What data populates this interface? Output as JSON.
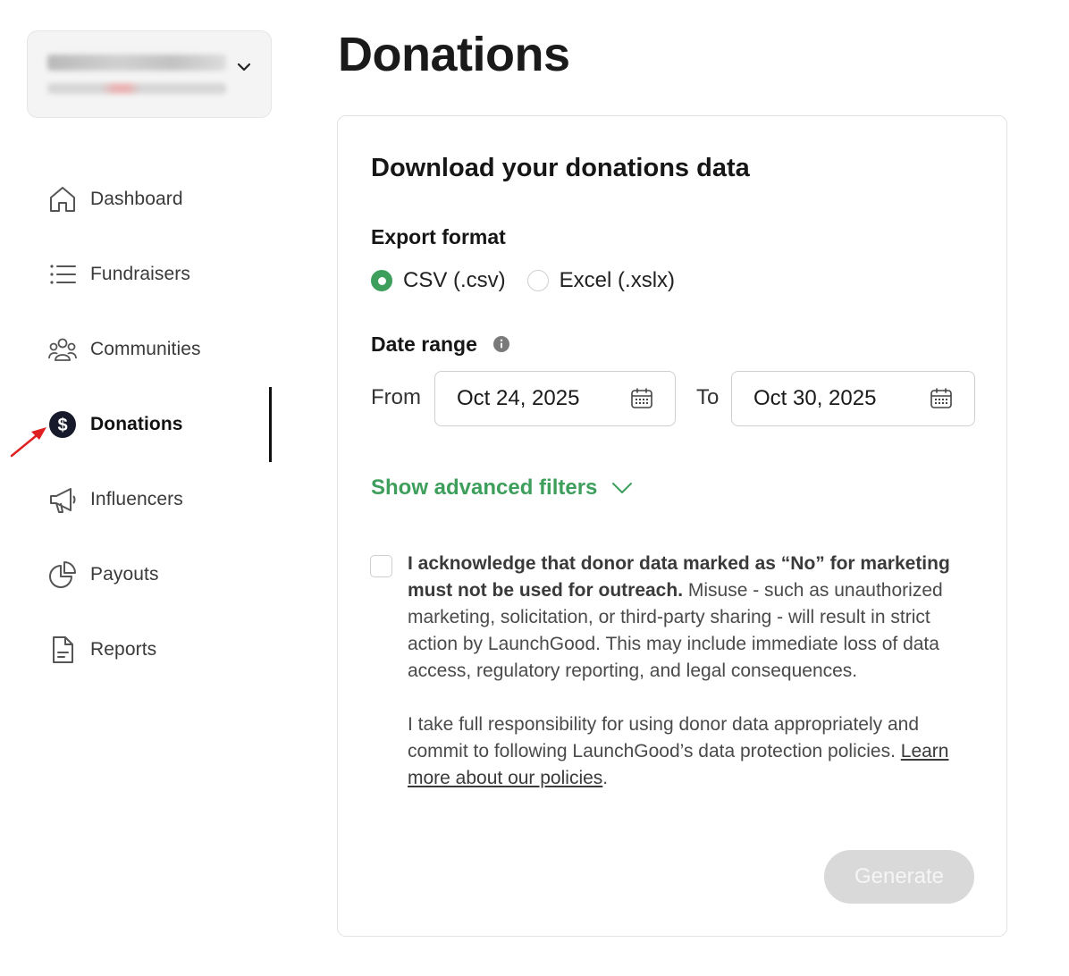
{
  "page": {
    "title": "Donations"
  },
  "sidebar": {
    "items": [
      {
        "label": "Dashboard",
        "icon": "home-icon",
        "active": false
      },
      {
        "label": "Fundraisers",
        "icon": "list-icon",
        "active": false
      },
      {
        "label": "Communities",
        "icon": "people-icon",
        "active": false
      },
      {
        "label": "Donations",
        "icon": "dollar-circle-icon",
        "active": true
      },
      {
        "label": "Influencers",
        "icon": "megaphone-icon",
        "active": false
      },
      {
        "label": "Payouts",
        "icon": "pie-chart-icon",
        "active": false
      },
      {
        "label": "Reports",
        "icon": "document-icon",
        "active": false
      }
    ]
  },
  "card": {
    "title": "Download your donations data",
    "export": {
      "label": "Export format",
      "options": [
        {
          "label": "CSV (.csv)",
          "selected": true
        },
        {
          "label": "Excel (.xslx)",
          "selected": false
        }
      ]
    },
    "date_range": {
      "label": "Date range",
      "from_label": "From",
      "from_value": "Oct 24, 2025",
      "to_label": "To",
      "to_value": "Oct 30, 2025"
    },
    "advanced_filters_label": "Show advanced filters",
    "acknowledgement": {
      "checked": false,
      "bold": "I acknowledge that donor data marked as “No” for marketing must not be used for outreach.",
      "text": " Misuse - such as unauthorized marketing, solicitation, or third-party sharing - will result in strict action by LaunchGood. This may include immediate loss of data access, regulatory reporting, and legal consequences.",
      "para2": "I take full responsibility for using donor data appropriately and commit to following LaunchGood’s data protection policies. ",
      "link": "Learn more about our policies",
      "end": "."
    },
    "generate_label": "Generate"
  },
  "colors": {
    "accent_green": "#3e9f5d",
    "disabled_button": "#d9d9d9",
    "annotation_arrow": "#e02020"
  }
}
